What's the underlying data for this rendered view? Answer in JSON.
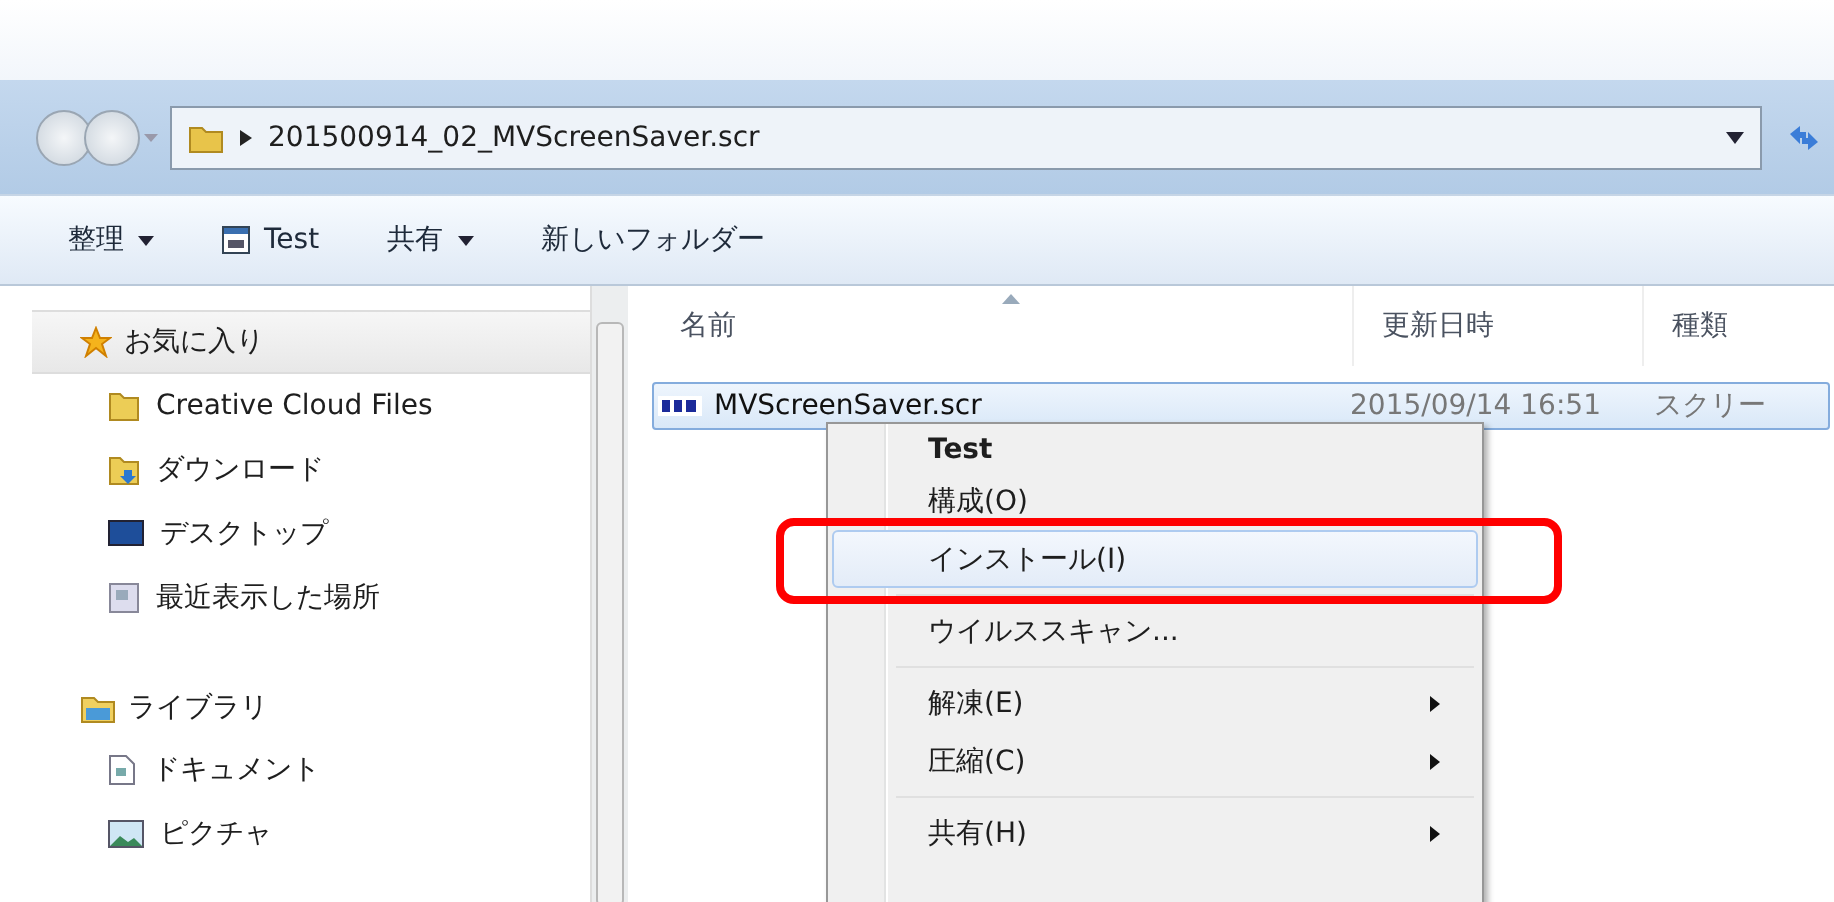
{
  "address_bar": {
    "path": "201500914_02_MVScreenSaver.scr"
  },
  "toolbar": [
    {
      "label": "整理",
      "kind": "dropdown"
    },
    {
      "label": "Test",
      "kind": "app"
    },
    {
      "label": "共有",
      "kind": "dropdown"
    },
    {
      "label": "新しいフォルダー",
      "kind": "plain"
    }
  ],
  "sidebar": {
    "groups": [
      {
        "label": "お気に入り",
        "kind": "star",
        "selected": true,
        "children": [
          {
            "label": "Creative Cloud Files",
            "kind": "folder"
          },
          {
            "label": "ダウンロード",
            "kind": "download"
          },
          {
            "label": "デスクトップ",
            "kind": "desktop"
          },
          {
            "label": "最近表示した場所",
            "kind": "recent"
          }
        ]
      },
      {
        "label": "ライブラリ",
        "kind": "library",
        "selected": false,
        "children": [
          {
            "label": "ドキュメント",
            "kind": "document"
          },
          {
            "label": "ピクチャ",
            "kind": "picture"
          }
        ]
      }
    ]
  },
  "table": {
    "columns": [
      {
        "label": "名前",
        "sorted": true
      },
      {
        "label": "更新日時",
        "sorted": false
      },
      {
        "label": "種類",
        "sorted": false
      }
    ],
    "rows": [
      {
        "name": "MVScreenSaver.scr",
        "modified": "2015/09/14 16:51",
        "type": "スクリー",
        "selected": true
      }
    ]
  },
  "context_menu": [
    {
      "kind": "default",
      "label": "Test",
      "selected": false
    },
    {
      "kind": "item",
      "label": "構成(O)",
      "selected": false
    },
    {
      "kind": "item",
      "label": "インストール(I)",
      "selected": true,
      "annotated": true
    },
    {
      "kind": "separator"
    },
    {
      "kind": "item",
      "label": "ウイルススキャン...",
      "selected": false
    },
    {
      "kind": "separator"
    },
    {
      "kind": "submenu",
      "label": "解凍(E)",
      "selected": false
    },
    {
      "kind": "submenu",
      "label": "圧縮(C)",
      "selected": false
    },
    {
      "kind": "separator"
    },
    {
      "kind": "submenu",
      "label": "共有(H)",
      "selected": false
    }
  ]
}
